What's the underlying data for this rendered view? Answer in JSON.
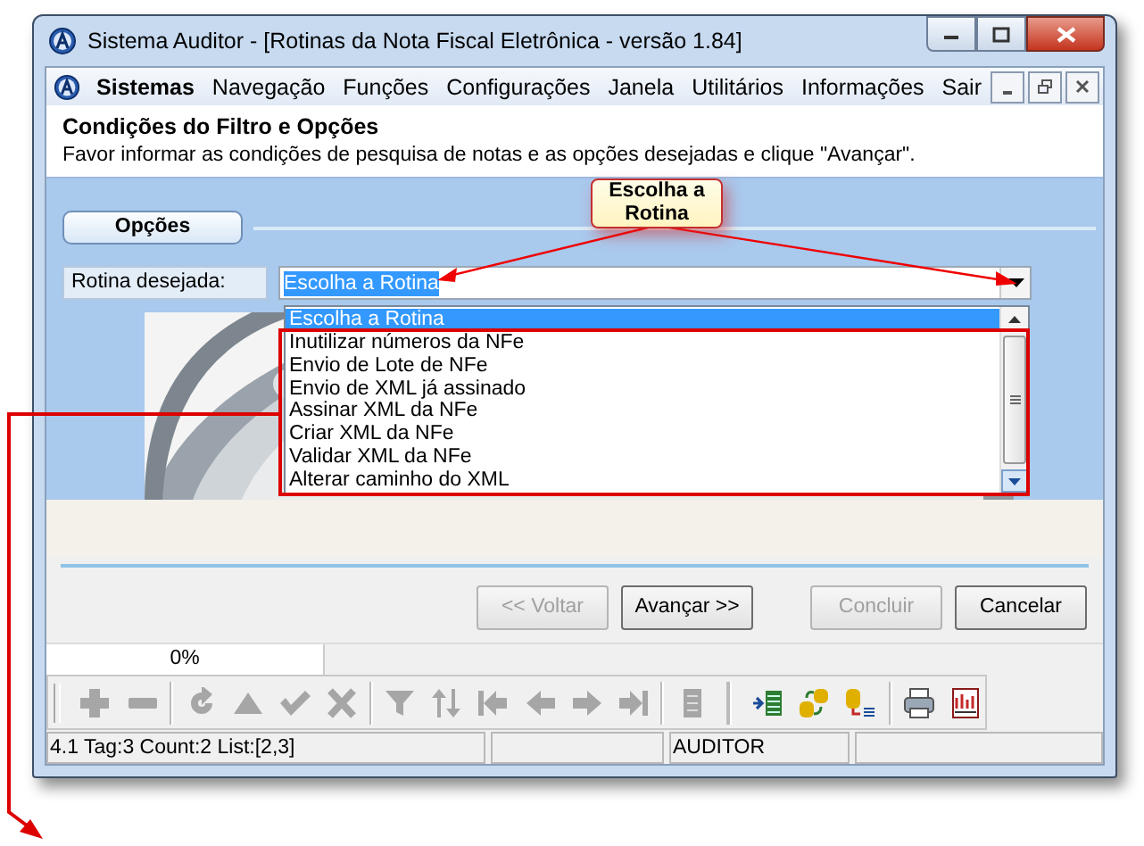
{
  "window": {
    "title": "Sistema Auditor - [Rotinas da Nota Fiscal Eletrônica - versão 1.84]"
  },
  "menu": [
    {
      "label": "Sistemas",
      "bold": true
    },
    {
      "label": "Navegação",
      "bold": false
    },
    {
      "label": "Funções",
      "bold": false
    },
    {
      "label": "Configurações",
      "bold": false
    },
    {
      "label": "Janela",
      "bold": false
    },
    {
      "label": "Utilitários",
      "bold": false
    },
    {
      "label": "Informações",
      "bold": false
    },
    {
      "label": "Sair",
      "bold": false
    }
  ],
  "header": {
    "title": "Condições do Filtro e Opções",
    "text": "Favor informar as condições de pesquisa de notas e as opções desejadas e clique \"Avançar\"."
  },
  "options_tab": "Opções",
  "field": {
    "label": "Rotina desejada:",
    "value": "Escolha a Rotina"
  },
  "dropdown": [
    {
      "label": "Escolha a Rotina",
      "selected": true
    },
    {
      "label": "Inutilizar números da NFe",
      "selected": false
    },
    {
      "label": "Envio de Lote de NFe",
      "selected": false
    },
    {
      "label": "Envio de XML já assinado",
      "selected": false
    },
    {
      "label": "Assinar XML da NFe",
      "selected": false
    },
    {
      "label": "Criar XML da NFe",
      "selected": false
    },
    {
      "label": "Validar XML da NFe",
      "selected": false
    },
    {
      "label": "Alterar caminho do XML",
      "selected": false
    }
  ],
  "callout": {
    "text": "Escolha a Rotina"
  },
  "buttons": [
    {
      "label": "<< Voltar",
      "disabled": true
    },
    {
      "label": "Avançar >>",
      "disabled": false
    },
    {
      "label": "Concluir",
      "disabled": true
    },
    {
      "label": "Cancelar",
      "disabled": false
    }
  ],
  "progress": {
    "text": "0%",
    "level": 0
  },
  "toolbar": [
    [
      {
        "kind": "plus",
        "disabled": true
      },
      {
        "kind": "minus",
        "disabled": true
      }
    ],
    [
      {
        "kind": "refresh",
        "disabled": true
      },
      {
        "kind": "up",
        "disabled": true
      },
      {
        "kind": "check",
        "disabled": true
      },
      {
        "kind": "cross",
        "disabled": true
      }
    ],
    [
      {
        "kind": "filter",
        "disabled": true
      },
      {
        "kind": "sort",
        "disabled": true
      },
      {
        "kind": "first",
        "disabled": true
      },
      {
        "kind": "prev",
        "disabled": true
      },
      {
        "kind": "next",
        "disabled": true
      },
      {
        "kind": "last",
        "disabled": true
      }
    ],
    [
      {
        "kind": "doc",
        "disabled": true
      }
    ],
    [
      {
        "kind": "import",
        "disabled": false
      },
      {
        "kind": "swap",
        "disabled": false
      },
      {
        "kind": "dblist",
        "disabled": false
      }
    ],
    [
      {
        "kind": "print",
        "disabled": false
      },
      {
        "kind": "chart",
        "disabled": false
      }
    ]
  ],
  "status_bar": [
    {
      "kind": "text",
      "text": "4.1 Tag:3 Count:2 List:[2,3]"
    },
    {
      "kind": "blank"
    },
    {
      "kind": "text",
      "text": "AUDITOR"
    },
    {
      "kind": "blank"
    }
  ]
}
